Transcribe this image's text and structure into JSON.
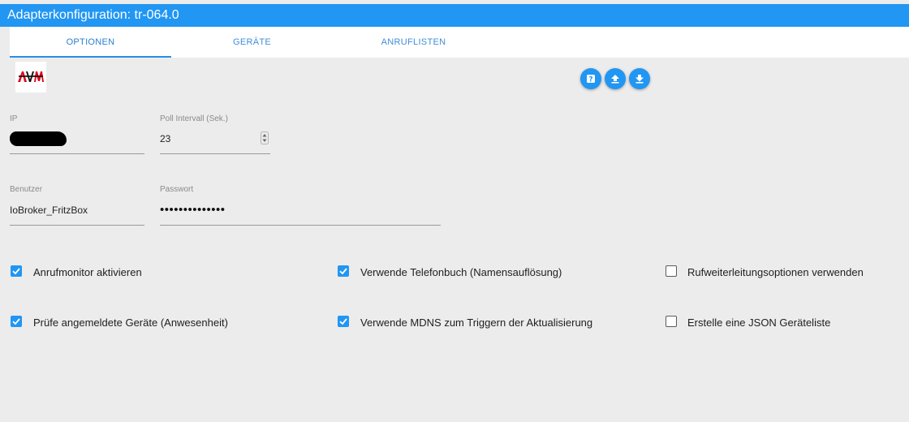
{
  "window": {
    "title": "Adapterkonfiguration: tr-064.0"
  },
  "tabs": [
    {
      "label": "OPTIONEN",
      "active": true
    },
    {
      "label": "GERÄTE",
      "active": false
    },
    {
      "label": "ANRUFLISTEN",
      "active": false
    }
  ],
  "logo": {
    "text": "AVM"
  },
  "actions": [
    {
      "icon": "help-icon"
    },
    {
      "icon": "upload-icon"
    },
    {
      "icon": "download-icon"
    }
  ],
  "form": {
    "ip": {
      "label": "IP",
      "value": ""
    },
    "poll": {
      "label": "Poll Intervall (Sek.)",
      "value": "23"
    },
    "user": {
      "label": "Benutzer",
      "value": "IoBroker_FritzBox"
    },
    "password": {
      "label": "Passwort",
      "value": "••••••••••••••"
    }
  },
  "checkboxes": [
    {
      "label": "Anrufmonitor aktivieren",
      "checked": true
    },
    {
      "label": "Verwende Telefonbuch (Namensauflösung)",
      "checked": true
    },
    {
      "label": "Rufweiterleitungsoptionen verwenden",
      "checked": false
    },
    {
      "label": "Prüfe angemeldete Geräte (Anwesenheit)",
      "checked": true
    },
    {
      "label": "Verwende MDNS zum Triggern der Aktualisierung",
      "checked": true
    },
    {
      "label": "Erstelle eine JSON Geräteliste",
      "checked": false
    }
  ],
  "colors": {
    "accent": "#2196f3",
    "background": "#ececec",
    "logo_red": "#e2001a"
  }
}
